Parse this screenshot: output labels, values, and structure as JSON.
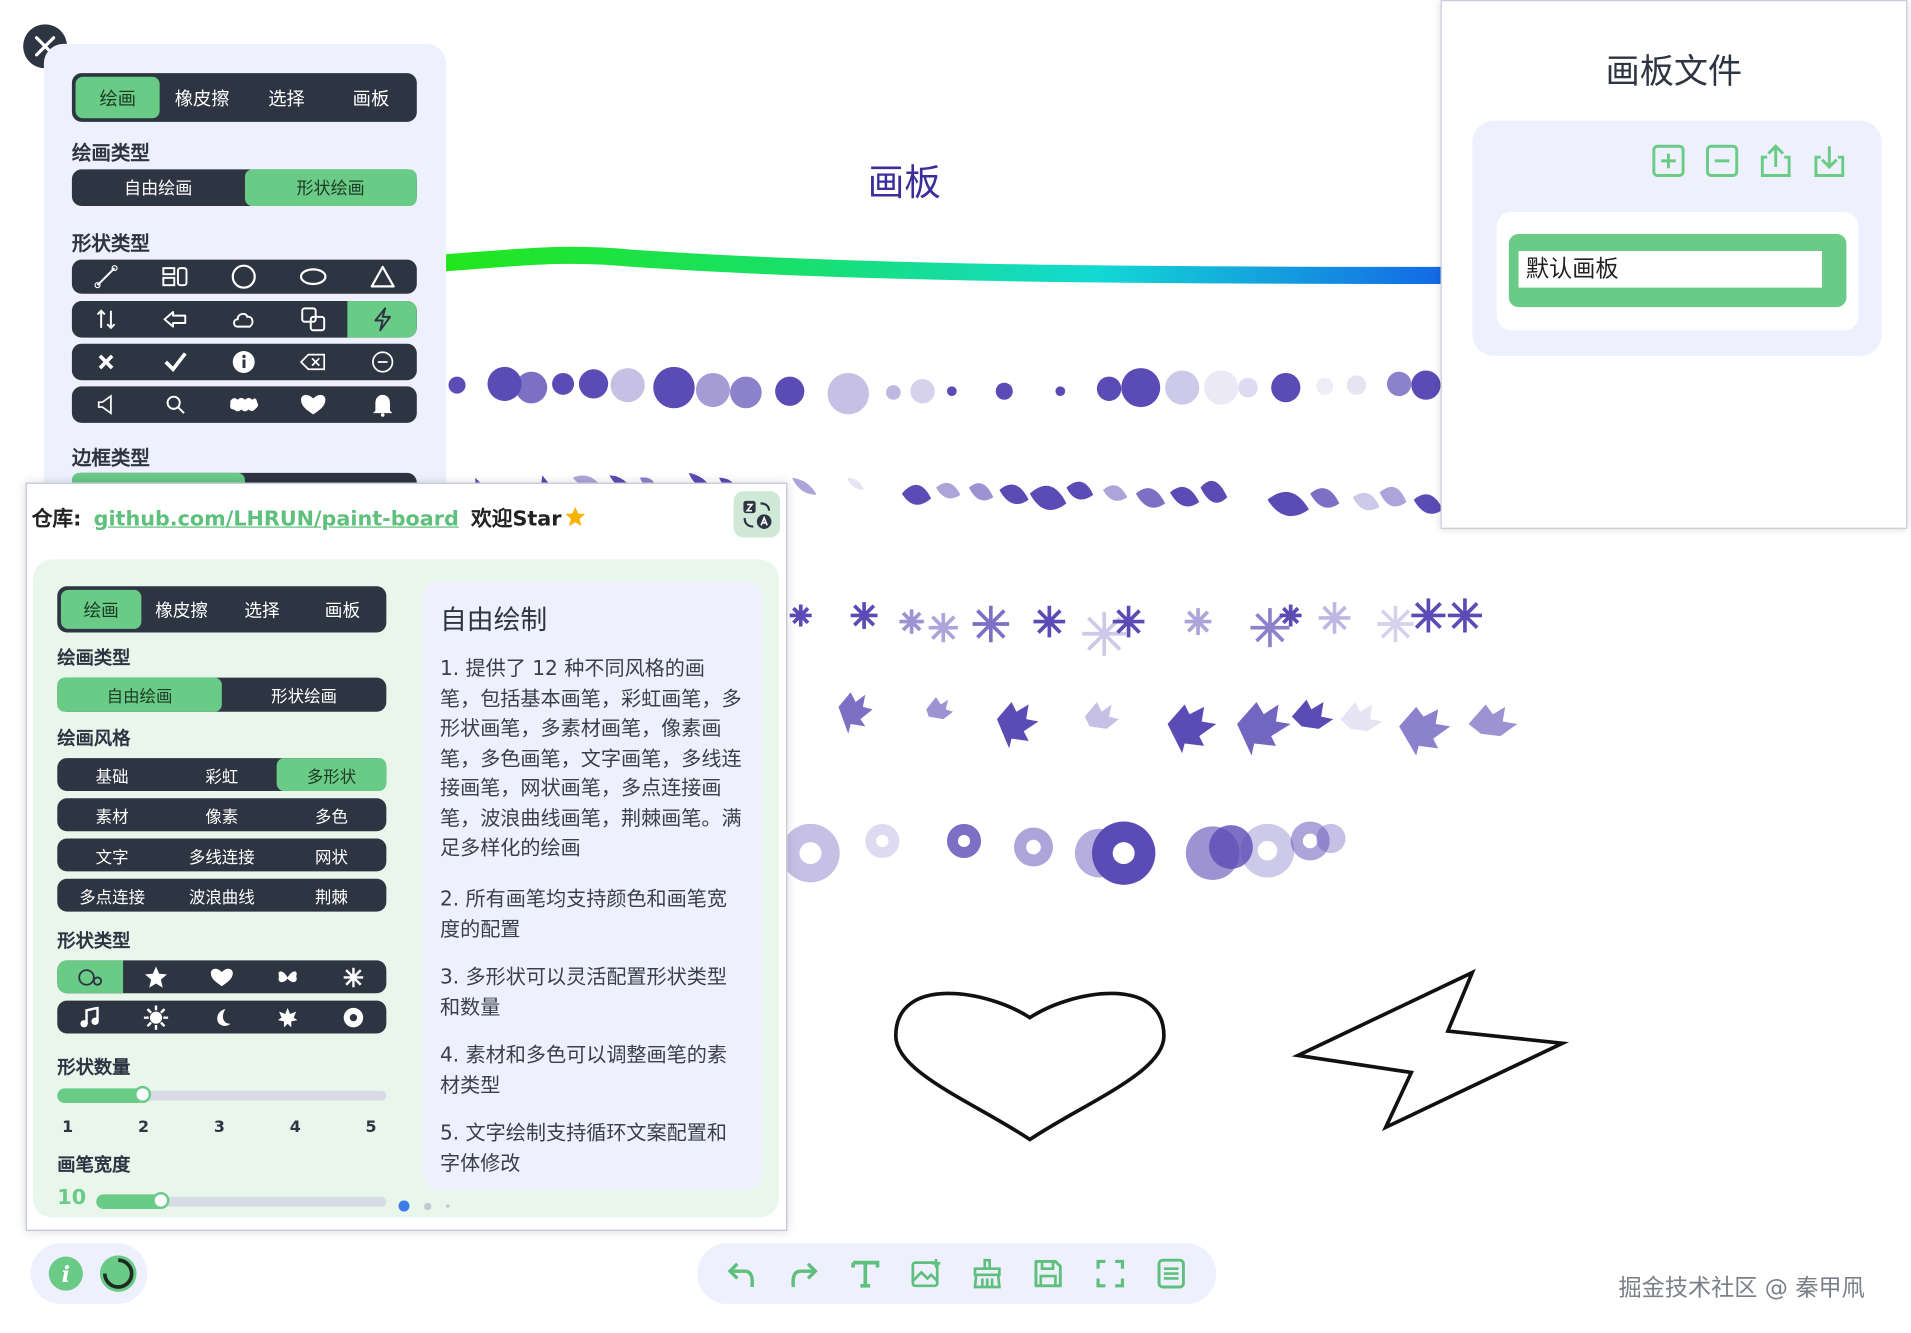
{
  "canvas": {
    "title": "画板"
  },
  "close_label": "×",
  "main_panel": {
    "tabs": [
      "绘画",
      "橡皮擦",
      "选择",
      "画板"
    ],
    "active_tab": 0,
    "draw_type_title": "绘画类型",
    "draw_types": [
      "自由绘画",
      "形状绘画"
    ],
    "active_draw_type": 1,
    "shape_type_title": "形状类型",
    "shape_icons": [
      [
        "line-icon",
        "rect-group-icon",
        "circle-icon",
        "ellipse-icon",
        "triangle-icon"
      ],
      [
        "arrows-icon",
        "arrow-left-icon",
        "cloud-icon",
        "copy-icon",
        "lightning-icon"
      ],
      [
        "x-icon",
        "check-icon",
        "info-icon",
        "backspace-icon",
        "minus-circle-icon"
      ],
      [
        "volume-icon",
        "search-icon",
        "wavy-rect-icon",
        "heart-icon",
        "bell-icon"
      ]
    ],
    "active_shape": "lightning-icon",
    "border_type_title": "边框类型"
  },
  "file_panel": {
    "title": "画板文件",
    "actions": [
      "add-icon",
      "remove-icon",
      "upload-icon",
      "download-icon"
    ],
    "items": [
      {
        "name": "默认画板"
      }
    ]
  },
  "info": {
    "repo_label": "仓库:",
    "repo_link": "github.com/LHRUN/paint-board",
    "star_text": "欢迎Star",
    "mini_panel": {
      "tabs": [
        "绘画",
        "橡皮擦",
        "选择",
        "画板"
      ],
      "draw_type_title": "绘画类型",
      "draw_types": [
        "自由绘画",
        "形状绘画"
      ],
      "style_title": "绘画风格",
      "styles": [
        [
          "基础",
          "彩虹",
          "多形状"
        ],
        [
          "素材",
          "像素",
          "多色"
        ],
        [
          "文字",
          "多线连接",
          "网状"
        ],
        [
          "多点连接",
          "波浪曲线",
          "荆棘"
        ]
      ],
      "active_style": "多形状",
      "shape_type_title": "形状类型",
      "shape_count_title": "形状数量",
      "shape_count_ticks": [
        "1",
        "2",
        "3",
        "4",
        "5"
      ],
      "shape_count_value": 2,
      "width_title": "画笔宽度",
      "width_value": "10"
    },
    "desc_title": "自由绘制",
    "desc_items": [
      "1. 提供了 12 种不同风格的画笔，包括基本画笔，彩虹画笔，多形状画笔，多素材画笔，像素画笔，多色画笔，文字画笔，多线连接画笔，网状画笔，多点连接画笔，波浪曲线画笔，荆棘画笔。满足多样化的绘画",
      "2. 所有画笔均支持颜色和画笔宽度的配置",
      "3. 多形状可以灵活配置形状类型和数量",
      "4. 素材和多色可以调整画笔的素材类型",
      "5. 文字绘制支持循环文案配置和字体修改"
    ],
    "page_index": 0
  },
  "bottom_left": [
    "info-icon",
    "loading-icon"
  ],
  "toolbar": [
    "undo-icon",
    "redo-icon",
    "text-icon",
    "image-icon",
    "clear-icon",
    "save-icon",
    "fullscreen-icon",
    "list-icon"
  ],
  "watermark": "掘金技术社区 @ 秦甲凧",
  "colors": {
    "accent": "#6acb87",
    "dark": "#2d3442",
    "panel": "#eef1fd",
    "purple": "#6a5acd",
    "title": "#3b2e9a"
  }
}
